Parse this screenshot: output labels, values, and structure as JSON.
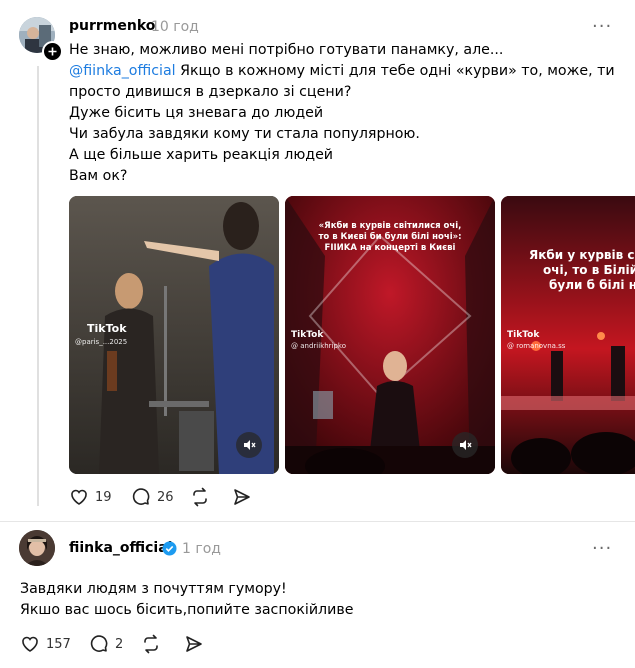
{
  "post1": {
    "username": "purrmenko",
    "time": "10 год",
    "more_label": "···",
    "lines": {
      "l1": "Не знаю, можливо мені потрібно готувати панамку, але...",
      "l2_mention": "@fiinka_official",
      "l2_rest": " Якщо в кожному місті для тебе одні «курви» то, може, ти",
      "l3": "просто дивишся в дзеркало зі сцени?",
      "l4": "Дуже бісить ця зневага до людей",
      "l5": "Чи забула завдяки кому ти стала популярною.",
      "l6": "А ще більше харить реакція людей",
      "l7": "Вам ок?"
    },
    "media": [
      {
        "tiktok": "TikTok",
        "handle": "@paris_...2025",
        "caption": ""
      },
      {
        "tiktok": "TikTok",
        "handle": "@ andriikhripko",
        "caption_lines": [
          "«Якби в курвів світилися очі,",
          "то в Києві би були білі ночі»:",
          "FIIИKA на концерті в Києві"
        ]
      },
      {
        "tiktok": "TikTok",
        "handle": "@ romanovna.ss",
        "caption_lines": [
          "Якби у курвів сві",
          "очі, то в Білій Ц",
          "були б білі но"
        ]
      }
    ],
    "stats": {
      "likes": "19",
      "comments": "26",
      "reposts": "",
      "shares": ""
    }
  },
  "post2": {
    "username": "fiinka_official",
    "time": "1 год",
    "more_label": "···",
    "verified": true,
    "lines": {
      "l1": "Завдяки людям з почуттям гумору!",
      "l2": "Якшо вас шось бісить,попийте заспокійливе"
    },
    "stats": {
      "likes": "157",
      "comments": "2",
      "reposts": "",
      "shares": ""
    }
  },
  "colors": {
    "mention": "#1d7ce0",
    "verified": "#1d9bf0",
    "muted": "#999999"
  },
  "icons": [
    "plus-badge-icon",
    "heart-icon",
    "comment-icon",
    "repost-icon",
    "share-icon",
    "verified-icon",
    "mute-icon",
    "tiktok-icon"
  ]
}
